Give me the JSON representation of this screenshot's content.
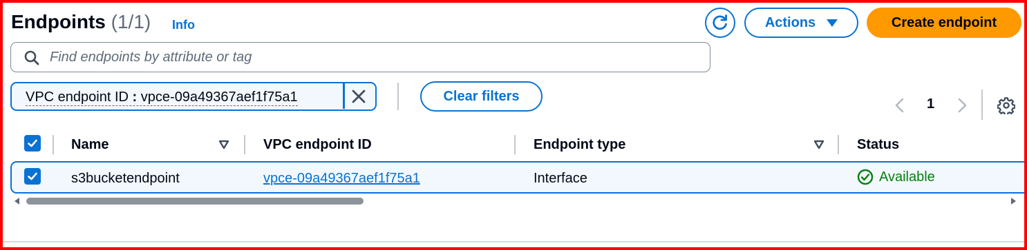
{
  "header": {
    "title": "Endpoints",
    "count": "(1/1)",
    "info_label": "Info",
    "refresh_icon": "refresh-icon",
    "actions_label": "Actions",
    "create_label": "Create endpoint"
  },
  "search": {
    "placeholder": "Find endpoints by attribute or tag",
    "value": ""
  },
  "filter": {
    "property": "VPC endpoint ID",
    "operator": ":",
    "value": "vpce-09a49367aef1f75a1",
    "clear_label": "Clear filters"
  },
  "pagination": {
    "current_page": "1"
  },
  "table": {
    "headers": {
      "name": "Name",
      "vpc_endpoint_id": "VPC endpoint ID",
      "endpoint_type": "Endpoint type",
      "status": "Status"
    },
    "select_all_checked": true,
    "rows": [
      {
        "selected": true,
        "name": "s3bucketendpoint",
        "vpc_endpoint_id": "vpce-09a49367aef1f75a1",
        "endpoint_type": "Interface",
        "status": "Available"
      }
    ]
  },
  "colors": {
    "accent": "#0972d3",
    "primary_button": "#ff9900",
    "status_success": "#037f0c",
    "frame_border": "#ff0000"
  }
}
